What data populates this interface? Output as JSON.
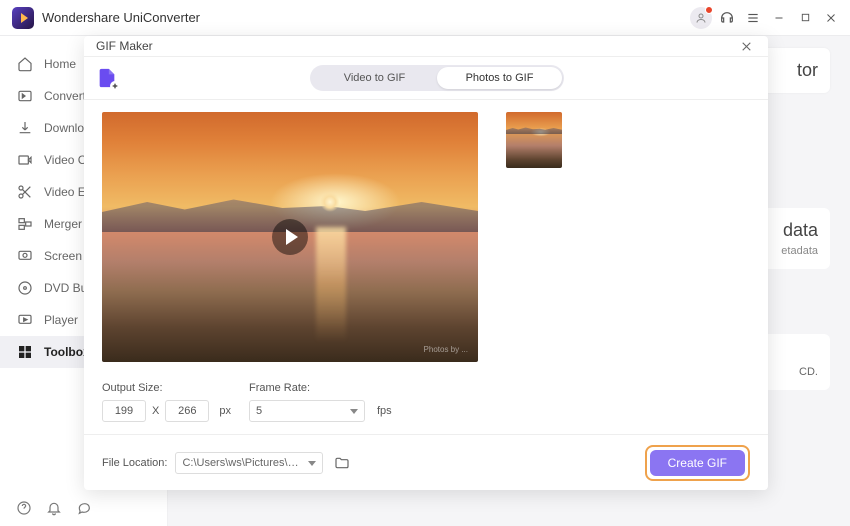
{
  "app": {
    "title": "Wondershare UniConverter"
  },
  "sidebar": {
    "items": [
      {
        "label": "Home"
      },
      {
        "label": "Converter"
      },
      {
        "label": "Downloader"
      },
      {
        "label": "Video Compressor"
      },
      {
        "label": "Video Editor"
      },
      {
        "label": "Merger"
      },
      {
        "label": "Screen Recorder"
      },
      {
        "label": "DVD Burner"
      },
      {
        "label": "Player"
      },
      {
        "label": "Toolbox"
      }
    ]
  },
  "background_cards": {
    "card1_suffix": "tor",
    "card2_title": "data",
    "card2_sub": "etadata",
    "card3_suffix": "CD."
  },
  "modal": {
    "title": "GIF Maker",
    "tabs": {
      "video": "Video to GIF",
      "photos": "Photos to GIF"
    },
    "output_size_label": "Output Size:",
    "frame_rate_label": "Frame Rate:",
    "width": "199",
    "height": "266",
    "x": "X",
    "px": "px",
    "fps_value": "5",
    "fps_unit": "fps",
    "file_location_label": "File Location:",
    "file_location_value": "C:\\Users\\ws\\Pictures\\Wonders",
    "create_label": "Create GIF",
    "watermark": "Photos by ..."
  }
}
